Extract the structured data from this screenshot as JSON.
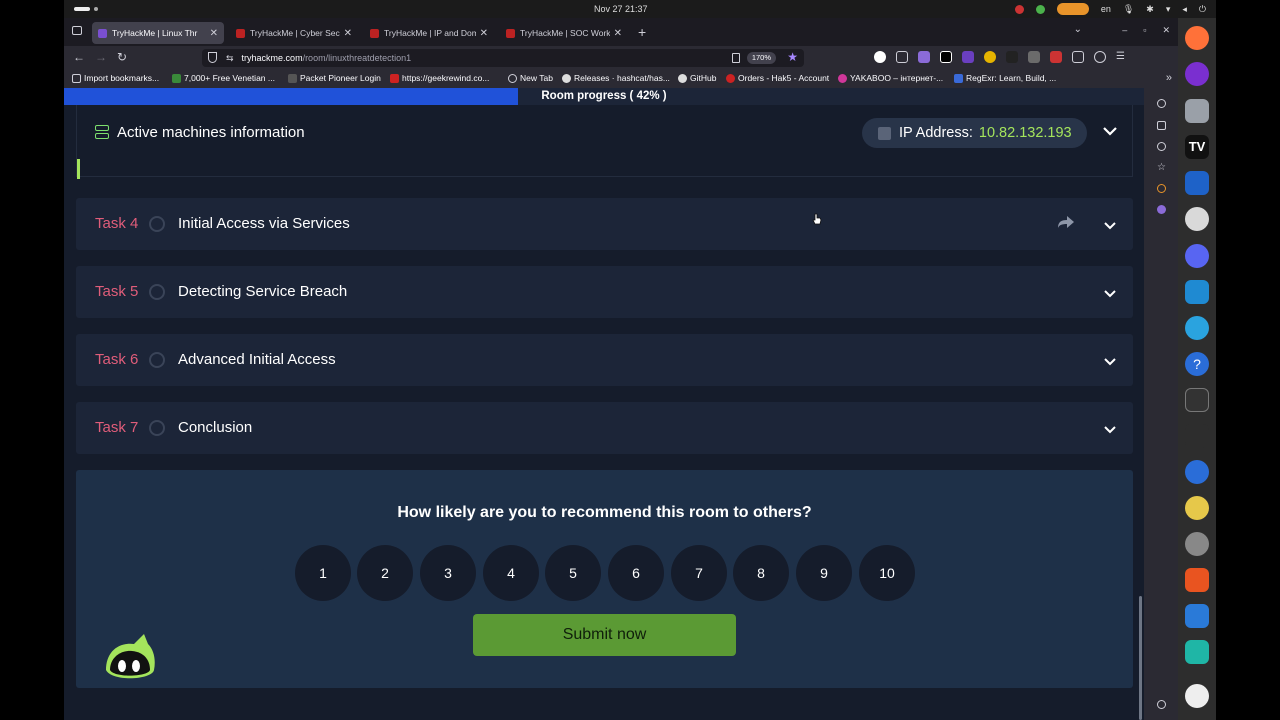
{
  "os": {
    "clock": "Nov 27  21:37",
    "lang": "en"
  },
  "browser": {
    "tabs": [
      {
        "label": "TryHackMe | Linux Thr",
        "active": true
      },
      {
        "label": "TryHackMe | Cyber Securi",
        "active": false
      },
      {
        "label": "TryHackMe | IP and Doma",
        "active": false
      },
      {
        "label": "TryHackMe | SOC Workbo",
        "active": false
      }
    ],
    "url_host": "tryhackme.com",
    "url_path": "/room/linuxthreatdetection1",
    "zoom": "170%",
    "bookmarks": [
      "Import bookmarks...",
      "7,000+ Free Venetian ...",
      "Packet Pioneer Login",
      "https://geekrewind.co...",
      "New Tab",
      "Releases · hashcat/has...",
      "GitHub",
      "Orders - Hak5 - Account",
      "YAKABOO – інтернет-...",
      "RegExr: Learn, Build, ..."
    ]
  },
  "room": {
    "progress_label": "Room progress ( 42% )",
    "progress_fraction": 0.42,
    "machines": {
      "title": "Active machines information",
      "ip_label": "IP Address:",
      "ip_value": "10.82.132.193"
    },
    "tasks": [
      {
        "number": "Task 4",
        "title": "Initial Access via Services"
      },
      {
        "number": "Task 5",
        "title": "Detecting Service Breach"
      },
      {
        "number": "Task 6",
        "title": "Advanced Initial Access"
      },
      {
        "number": "Task 7",
        "title": "Conclusion"
      }
    ],
    "recommend": {
      "question": "How likely are you to recommend this room to others?",
      "ratings": [
        "1",
        "2",
        "3",
        "4",
        "5",
        "6",
        "7",
        "8",
        "9",
        "10"
      ],
      "submit_label": "Submit now"
    }
  },
  "colors": {
    "task_number": "#e05d7a",
    "ip_value": "#a4e45c",
    "submit": "#5b9a34",
    "progress_fill": "#2052d9"
  }
}
